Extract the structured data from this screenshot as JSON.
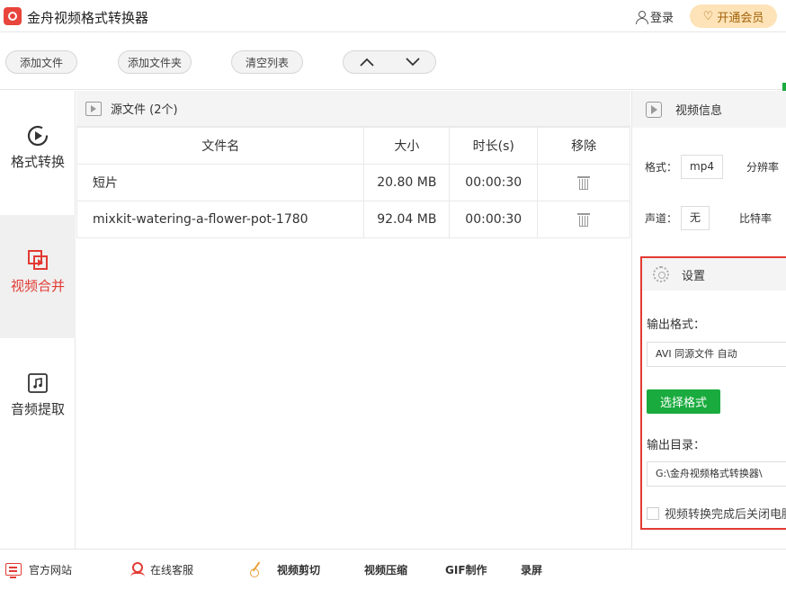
{
  "app": {
    "title": "金舟视频格式转换器",
    "login_label": "登录",
    "vip_label": "开通会员"
  },
  "toolbar": {
    "add_file": "添加文件",
    "add_folder": "添加文件夹",
    "clear_list": "清空列表",
    "move_up": "∧",
    "move_down": "∨"
  },
  "nav": {
    "items": [
      {
        "label": "格式转换",
        "icon": "convert-icon",
        "active": false
      },
      {
        "label": "视频合并",
        "icon": "merge-icon",
        "active": true
      },
      {
        "label": "音频提取",
        "icon": "music-icon",
        "active": false
      }
    ]
  },
  "files": {
    "header": "源文件 (2个)",
    "columns": [
      "文件名",
      "大小",
      "时长(s)",
      "移除"
    ],
    "rows": [
      {
        "name": "短片",
        "size": "20.80 MB",
        "duration": "00:00:30"
      },
      {
        "name": "mixkit-watering-a-flower-pot-1780",
        "size": "92.04 MB",
        "duration": "00:00:30"
      }
    ]
  },
  "video_info": {
    "header": "视频信息",
    "format_label": "格式：",
    "format_value": "mp4",
    "resolution_label": "分辨率",
    "channel_label": "声道：",
    "channel_value": "无",
    "bitrate_label": "比特率"
  },
  "settings": {
    "header": "设置",
    "output_format_label": "输出格式：",
    "output_format_value": "AVI 同源文件 自动",
    "choose_format_button": "选择格式",
    "output_dir_label": "输出目录：",
    "output_dir_value": "G:\\金舟视频格式转换器\\",
    "shutdown_label": "视频转换完成后关闭电脑"
  },
  "bottom": {
    "website": "官方网站",
    "support": "在线客服",
    "cut": "视频剪切",
    "compress": "视频压缩",
    "gif": "GIF制作",
    "record": "录屏"
  },
  "colors": {
    "accent_red": "#e23b33",
    "green": "#1aab3e",
    "vip_bg": "#fde3b7"
  }
}
